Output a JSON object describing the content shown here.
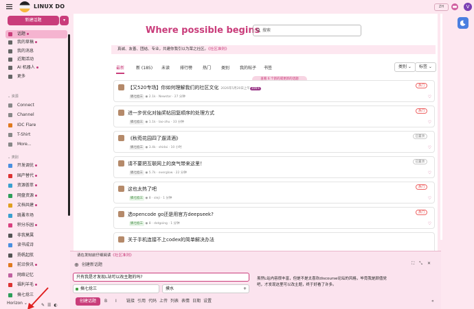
{
  "header": {
    "site_title": "LINUX DO",
    "lang_label": "ZH",
    "avatar_letter": "V"
  },
  "sidebar": {
    "new_topic": "新建话题",
    "items_main": [
      {
        "label": "话题",
        "dot": true,
        "active": true,
        "icon_color": "#c93c7a"
      },
      {
        "label": "我的草稿",
        "dot": true,
        "active": false,
        "icon_color": "#666"
      },
      {
        "label": "我的消息",
        "dot": false,
        "active": false,
        "icon_color": "#666"
      },
      {
        "label": "近期活动",
        "dot": false,
        "active": false,
        "icon_color": "#666"
      },
      {
        "label": "AI 机器人",
        "dot": true,
        "active": false,
        "icon_color": "#666"
      },
      {
        "label": "更多",
        "dot": false,
        "active": false,
        "icon_color": "#666"
      }
    ],
    "section_resources": "资源",
    "items_resources": [
      {
        "label": "Connect",
        "icon_color": "#888"
      },
      {
        "label": "Channel",
        "icon_color": "#888"
      },
      {
        "label": "IDC Flare",
        "icon_color": "#e07a1f"
      },
      {
        "label": "T-Shirt",
        "icon_color": "#888"
      },
      {
        "label": "More...",
        "icon_color": "#888"
      }
    ],
    "section_categories": "类别",
    "items_categories": [
      {
        "label": "开发调优",
        "dot": true,
        "icon_color": "#4a8fe0"
      },
      {
        "label": "国产替代",
        "dot": true,
        "icon_color": "#d33"
      },
      {
        "label": "资源荟萃",
        "dot": true,
        "icon_color": "#3aa0d0"
      },
      {
        "label": "网盘资源",
        "dot": true,
        "icon_color": "#2e9e5a"
      },
      {
        "label": "文档共建",
        "dot": true,
        "icon_color": "#e0a020"
      },
      {
        "label": "跳蚤市场",
        "dot": false,
        "icon_color": "#3aa0d0"
      },
      {
        "label": "积分乐园",
        "dot": true,
        "icon_color": "#d94080"
      },
      {
        "label": "非我莫属",
        "dot": false,
        "icon_color": "#555"
      },
      {
        "label": "读书成诗",
        "dot": false,
        "icon_color": "#4a8fe0"
      },
      {
        "label": "扬帆起航",
        "dot": false,
        "icon_color": "#555"
      },
      {
        "label": "前沿快讯",
        "dot": true,
        "icon_color": "#e07a1f"
      },
      {
        "label": "网络记忆",
        "dot": false,
        "icon_color": "#c060a0"
      },
      {
        "label": "福利羊毛",
        "dot": true,
        "icon_color": "#d33"
      },
      {
        "label": "搞七捻三",
        "dot": false,
        "icon_color": "#2e9e5a"
      }
    ],
    "footer_theme": "Horizon"
  },
  "main": {
    "hero_title": "Where possible begins",
    "search_placeholder": "搜索",
    "banner_text": "真诚、友善、团结、专业，共建你我引以为荣之社区。",
    "banner_link": "《社区准则》",
    "tabs": [
      "最新",
      "新 (185)",
      "未读",
      "排行榜",
      "热门",
      "类别",
      "我的帖子",
      "书签"
    ],
    "tab_buttons": [
      "类别",
      "标签"
    ],
    "new_topics_pill": "查看 6 个新的或更新的话题",
    "topics": [
      {
        "title": "【又520专场】你如何理解我们的社区文化",
        "meta": "2026年5月20日上午",
        "badge": "100+",
        "category": "搞七捻三",
        "green": false,
        "stat1": "2.1k",
        "user": "Newstar",
        "time": "27 分钟",
        "tag": "热门",
        "tag_gray": false
      },
      {
        "title": "进一步优化对抽奖帖回复顺序的处理方式",
        "meta": "",
        "badge": "",
        "category": "搞七捻三",
        "green": false,
        "stat1": "1.1k",
        "user": "lao-zhu",
        "time": "33 分钟",
        "tag": "热门",
        "tag_gray": false
      },
      {
        "title": "《秋菀花园四了遛清酒》",
        "meta": "",
        "badge": "",
        "category": "搞七捻三",
        "green": false,
        "stat1": "3.4k",
        "user": "shidai",
        "time": "10 小时",
        "tag": "已置顶",
        "tag_gray": true
      },
      {
        "title": "请不要把互联网上的戾气带来这里！",
        "meta": "",
        "badge": "",
        "category": "搞七捻三",
        "green": false,
        "stat1": "5.7k",
        "user": "everglow",
        "time": "22 分钟",
        "tag": "已置顶",
        "tag_gray": true
      },
      {
        "title": "这也太热了吧",
        "meta": "",
        "badge": "",
        "category": "搞七捻三",
        "green": true,
        "stat1": "8",
        "user": "sleji",
        "time": "1 分钟",
        "tag": "热门",
        "tag_gray": false
      },
      {
        "title": "选opencode go还是用官方deepseek?",
        "meta": "",
        "badge": "",
        "category": "搞七捻三",
        "green": true,
        "stat1": "8",
        "user": "dotgoing",
        "time": "1 分钟",
        "tag": "热门",
        "tag_gray": false
      },
      {
        "title": "关于手机连接不上codex的简单解决办法",
        "meta": "",
        "badge": "",
        "category": "",
        "green": false,
        "stat1": "",
        "user": "",
        "time": "",
        "tag": "",
        "tag_gray": false
      }
    ]
  },
  "composer": {
    "notice": "请在发帖前仔细阅读",
    "notice_link": "《社区准则》",
    "head_label": "创建新话题",
    "title_value": "只有我是才发现L站可以改主题的吗?",
    "category_value": "搞七捻三",
    "tag_value": "摸水",
    "preview": "虽然L站内容很丰富，但是不是太喜欢discourse论坛的风格，毕竟我是颜值党吧，才发现这里可以改主题，终于好看了许多。",
    "submit_label": "创建话题",
    "toolbar_items": [
      "B",
      "I",
      "链接",
      "引用",
      "代码",
      "上传",
      "列表",
      "表情",
      "日期",
      "设置"
    ]
  }
}
